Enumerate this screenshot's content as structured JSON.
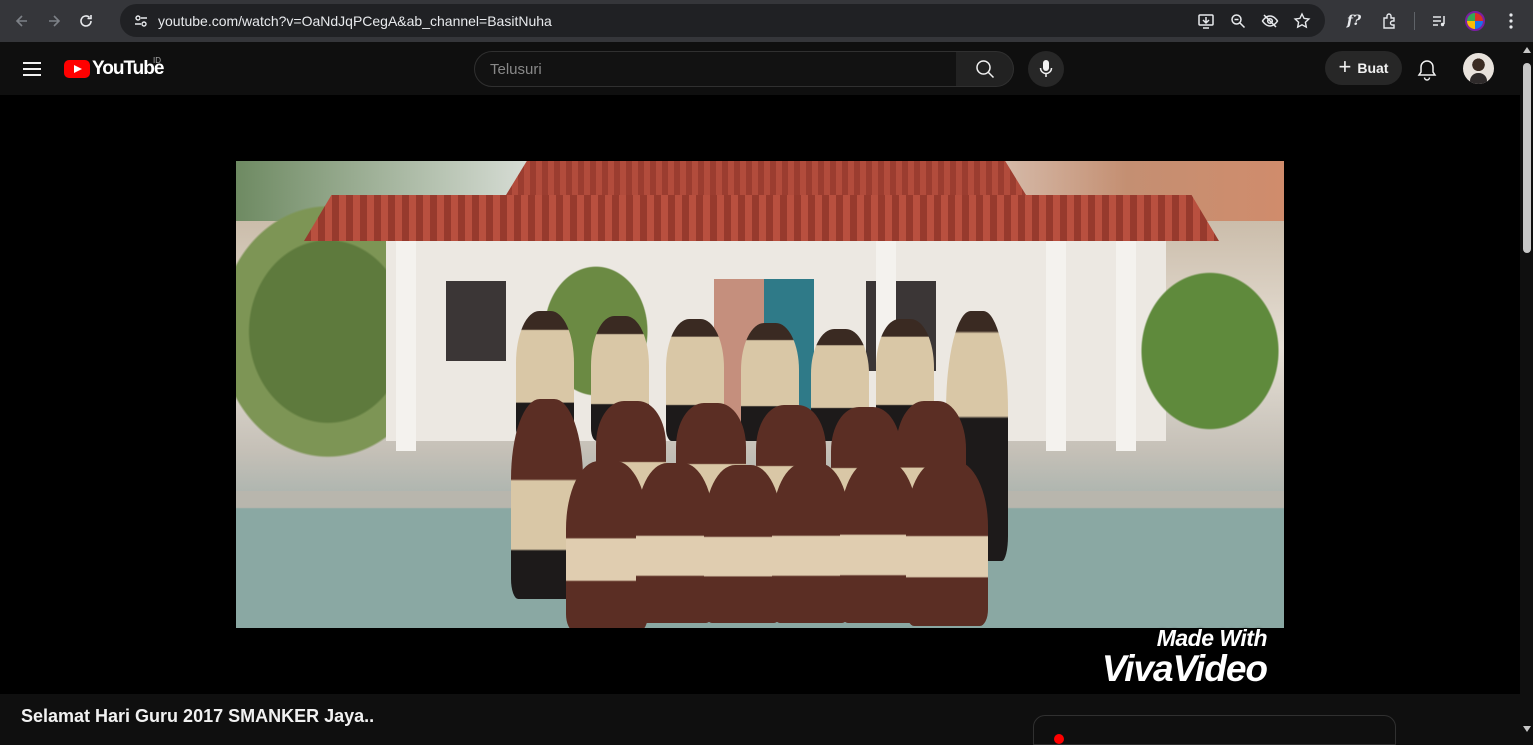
{
  "browser": {
    "url": "youtube.com/watch?v=OaNdJqPCegA&ab_channel=BasitNuha",
    "icons": [
      "back-icon",
      "forward-icon",
      "reload-icon",
      "site-info-icon",
      "install-icon",
      "zoom-icon",
      "eye-off-icon",
      "bookmark-star-icon",
      "font-extension-icon",
      "extensions-icon",
      "media-controls-icon",
      "profile-icon",
      "menu-icon"
    ]
  },
  "youtube": {
    "logo_text": "YouTube",
    "region": "ID",
    "search_placeholder": "Telusuri",
    "create_label": "Buat"
  },
  "player": {
    "watermark_line1": "Made With",
    "watermark_line2": "VivaVideo"
  },
  "video": {
    "title": "Selamat Hari Guru 2017 SMANKER Jaya.."
  },
  "colors": {
    "brand_red": "#ff0000",
    "background": "#0f0f0f",
    "chrome_bar": "#35363a",
    "omnibox": "#202124"
  }
}
